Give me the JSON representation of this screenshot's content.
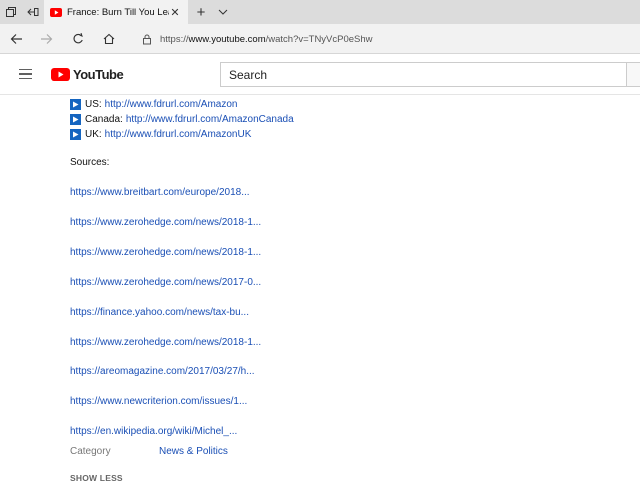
{
  "browser": {
    "tab": {
      "title": "France: Burn Till You Lea",
      "close_symbol": "✕"
    },
    "new_tab_symbol": "+",
    "address": {
      "scheme": "https://",
      "host": "www.youtube.com",
      "path": "/watch?v=TNyVcP0eShw"
    }
  },
  "youtube": {
    "logo_text": "YouTube",
    "search_placeholder": "Search",
    "brand_color": "#ff0000"
  },
  "description": {
    "stores": [
      {
        "label": "US:",
        "url": "http://www.fdrurl.com/Amazon"
      },
      {
        "label": "Canada:",
        "url": "http://www.fdrurl.com/AmazonCanada"
      },
      {
        "label": "UK:",
        "url": "http://www.fdrurl.com/AmazonUK"
      }
    ],
    "sources_heading": "Sources:",
    "sources": [
      "https://www.breitbart.com/europe/2018...",
      "https://www.zerohedge.com/news/2018-1...",
      "https://www.zerohedge.com/news/2018-1...",
      "https://www.zerohedge.com/news/2017-0...",
      "https://finance.yahoo.com/news/tax-bu...",
      "https://www.zerohedge.com/news/2018-1...",
      "https://areomagazine.com/2017/03/27/h...",
      "https://www.newcriterion.com/issues/1...",
      "https://en.wikipedia.org/wiki/Michel_..."
    ],
    "category_label": "Category",
    "category_value": "News & Politics",
    "show_less": "SHOW LESS",
    "link_color": "#1a4fb5"
  }
}
